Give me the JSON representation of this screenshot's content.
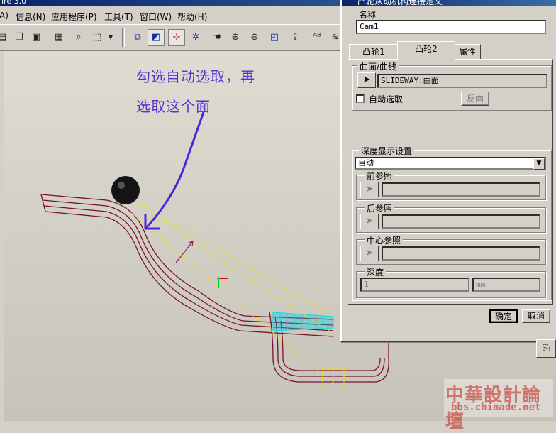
{
  "app": {
    "title_fragment": "ire 3.0"
  },
  "menu": [
    {
      "label": "A)"
    },
    {
      "label": "信息(N)"
    },
    {
      "label": "应用程序(P)"
    },
    {
      "label": "工具(T)"
    },
    {
      "label": "窗口(W)"
    },
    {
      "label": "帮助(H)"
    }
  ],
  "toolbar": {
    "icons": [
      "print-icon",
      "copy-icon",
      "paste-icon",
      "paste-special-icon",
      "regenerate-icon",
      "find-icon",
      "select-box-icon",
      "dropdown-icon",
      "named-views-icon",
      "repaint-icon",
      "spin-center-icon",
      "orient-icon",
      "pan-icon",
      "zoom-in-icon",
      "zoom-out-icon",
      "refit-icon",
      "view-icon",
      "annotation-icon",
      "layer-icon"
    ]
  },
  "annotation": {
    "line1": "勾选自动选取，再",
    "line2": "选取这个面"
  },
  "dialog": {
    "title": "凸轮从动机构连接定义",
    "name_label": "名称",
    "name_value": "Cam1",
    "tabs": [
      {
        "label": "凸轮1",
        "active": false
      },
      {
        "label": "凸轮2",
        "active": true
      },
      {
        "label": "属性",
        "active": false
      }
    ],
    "surface_group": "曲面/曲线",
    "surface_value": "SLIDEWAY:曲面",
    "auto_select_label": "自动选取",
    "auto_select_checked": false,
    "reverse_button": "反向",
    "depth_group": "深度显示设置",
    "depth_mode": "自动",
    "front_ref_label": "前参照",
    "back_ref_label": "后参照",
    "center_ref_label": "中心参照",
    "depth_label": "深度",
    "depth_value": "1",
    "depth_unit": "mm",
    "ok_button": "确定",
    "cancel_button": "取消"
  },
  "watermark": {
    "line1": "中華設計論壇",
    "line2": "bbs.chinade.net"
  },
  "colors": {
    "annotation": "#5a2fd0",
    "part_edges": "#7a1030",
    "highlight": "#00e0f0",
    "datum": "#f0e000",
    "watermark": "#c8241e"
  }
}
